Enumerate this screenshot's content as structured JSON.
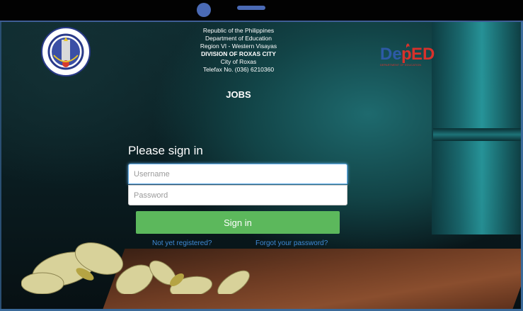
{
  "header": {
    "line1": "Republic of the Philippines",
    "line2": "Department of Education",
    "line3": "Region VI - Western Visayas",
    "line4": "DIVISION OF ROXAS CITY",
    "line5": "City of Roxas",
    "line6": "Telefax No. (036) 6210360"
  },
  "page_title": "JOBS",
  "seal": {
    "top_text": "KAGAWARAN NG EDUKASYON",
    "bottom_text": "REPUBLIKA NG PILIPINAS"
  },
  "logo": {
    "main": "DepED",
    "sub": "DEPARTMENT OF EDUCATION",
    "colors": {
      "blue": "#2d5aa6",
      "red": "#d9312b"
    }
  },
  "signin": {
    "title": "Please sign in",
    "username_placeholder": "Username",
    "password_placeholder": "Password",
    "button_label": "Sign in",
    "register_link": "Not yet registered?",
    "forgot_link": "Forgot your password?",
    "button_color": "#5cb85c",
    "link_color": "#3f8ad6"
  }
}
